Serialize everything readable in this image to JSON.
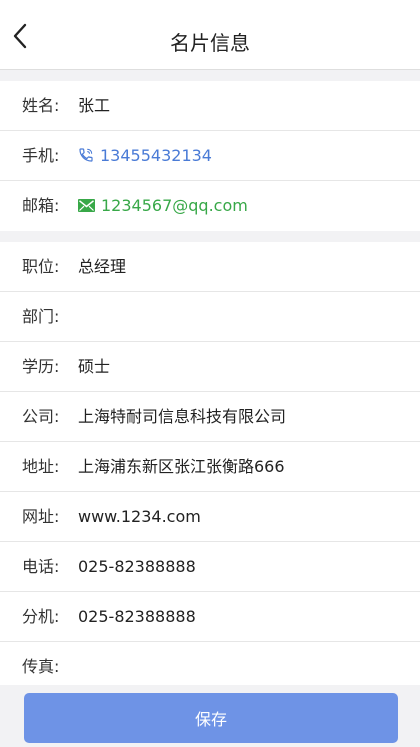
{
  "nav": {
    "title": "名片信息"
  },
  "contact": {
    "name": {
      "label": "姓名:",
      "value": "张工"
    },
    "mobile": {
      "label": "手机:",
      "value": "13455432134",
      "icon": "phone-icon",
      "color": "#4a7bd6"
    },
    "email": {
      "label": "邮箱:",
      "value": "1234567@qq.com",
      "icon": "mail-icon",
      "color": "#38a848"
    }
  },
  "details": {
    "position": {
      "label": "职位:",
      "value": "总经理"
    },
    "department": {
      "label": "部门:",
      "value": ""
    },
    "education": {
      "label": "学历:",
      "value": "硕士"
    },
    "company": {
      "label": "公司:",
      "value": "上海特耐司信息科技有限公司"
    },
    "address": {
      "label": "地址:",
      "value": "上海浦东新区张江张衡路666"
    },
    "website": {
      "label": "网址:",
      "value": "www.1234.com"
    },
    "telephone": {
      "label": "电话:",
      "value": "025-82388888"
    },
    "extension": {
      "label": "分机:",
      "value": "025-82388888"
    },
    "fax": {
      "label": "传真:",
      "value": ""
    }
  },
  "footer": {
    "save_label": "保存",
    "button_color": "#6e93e6"
  }
}
